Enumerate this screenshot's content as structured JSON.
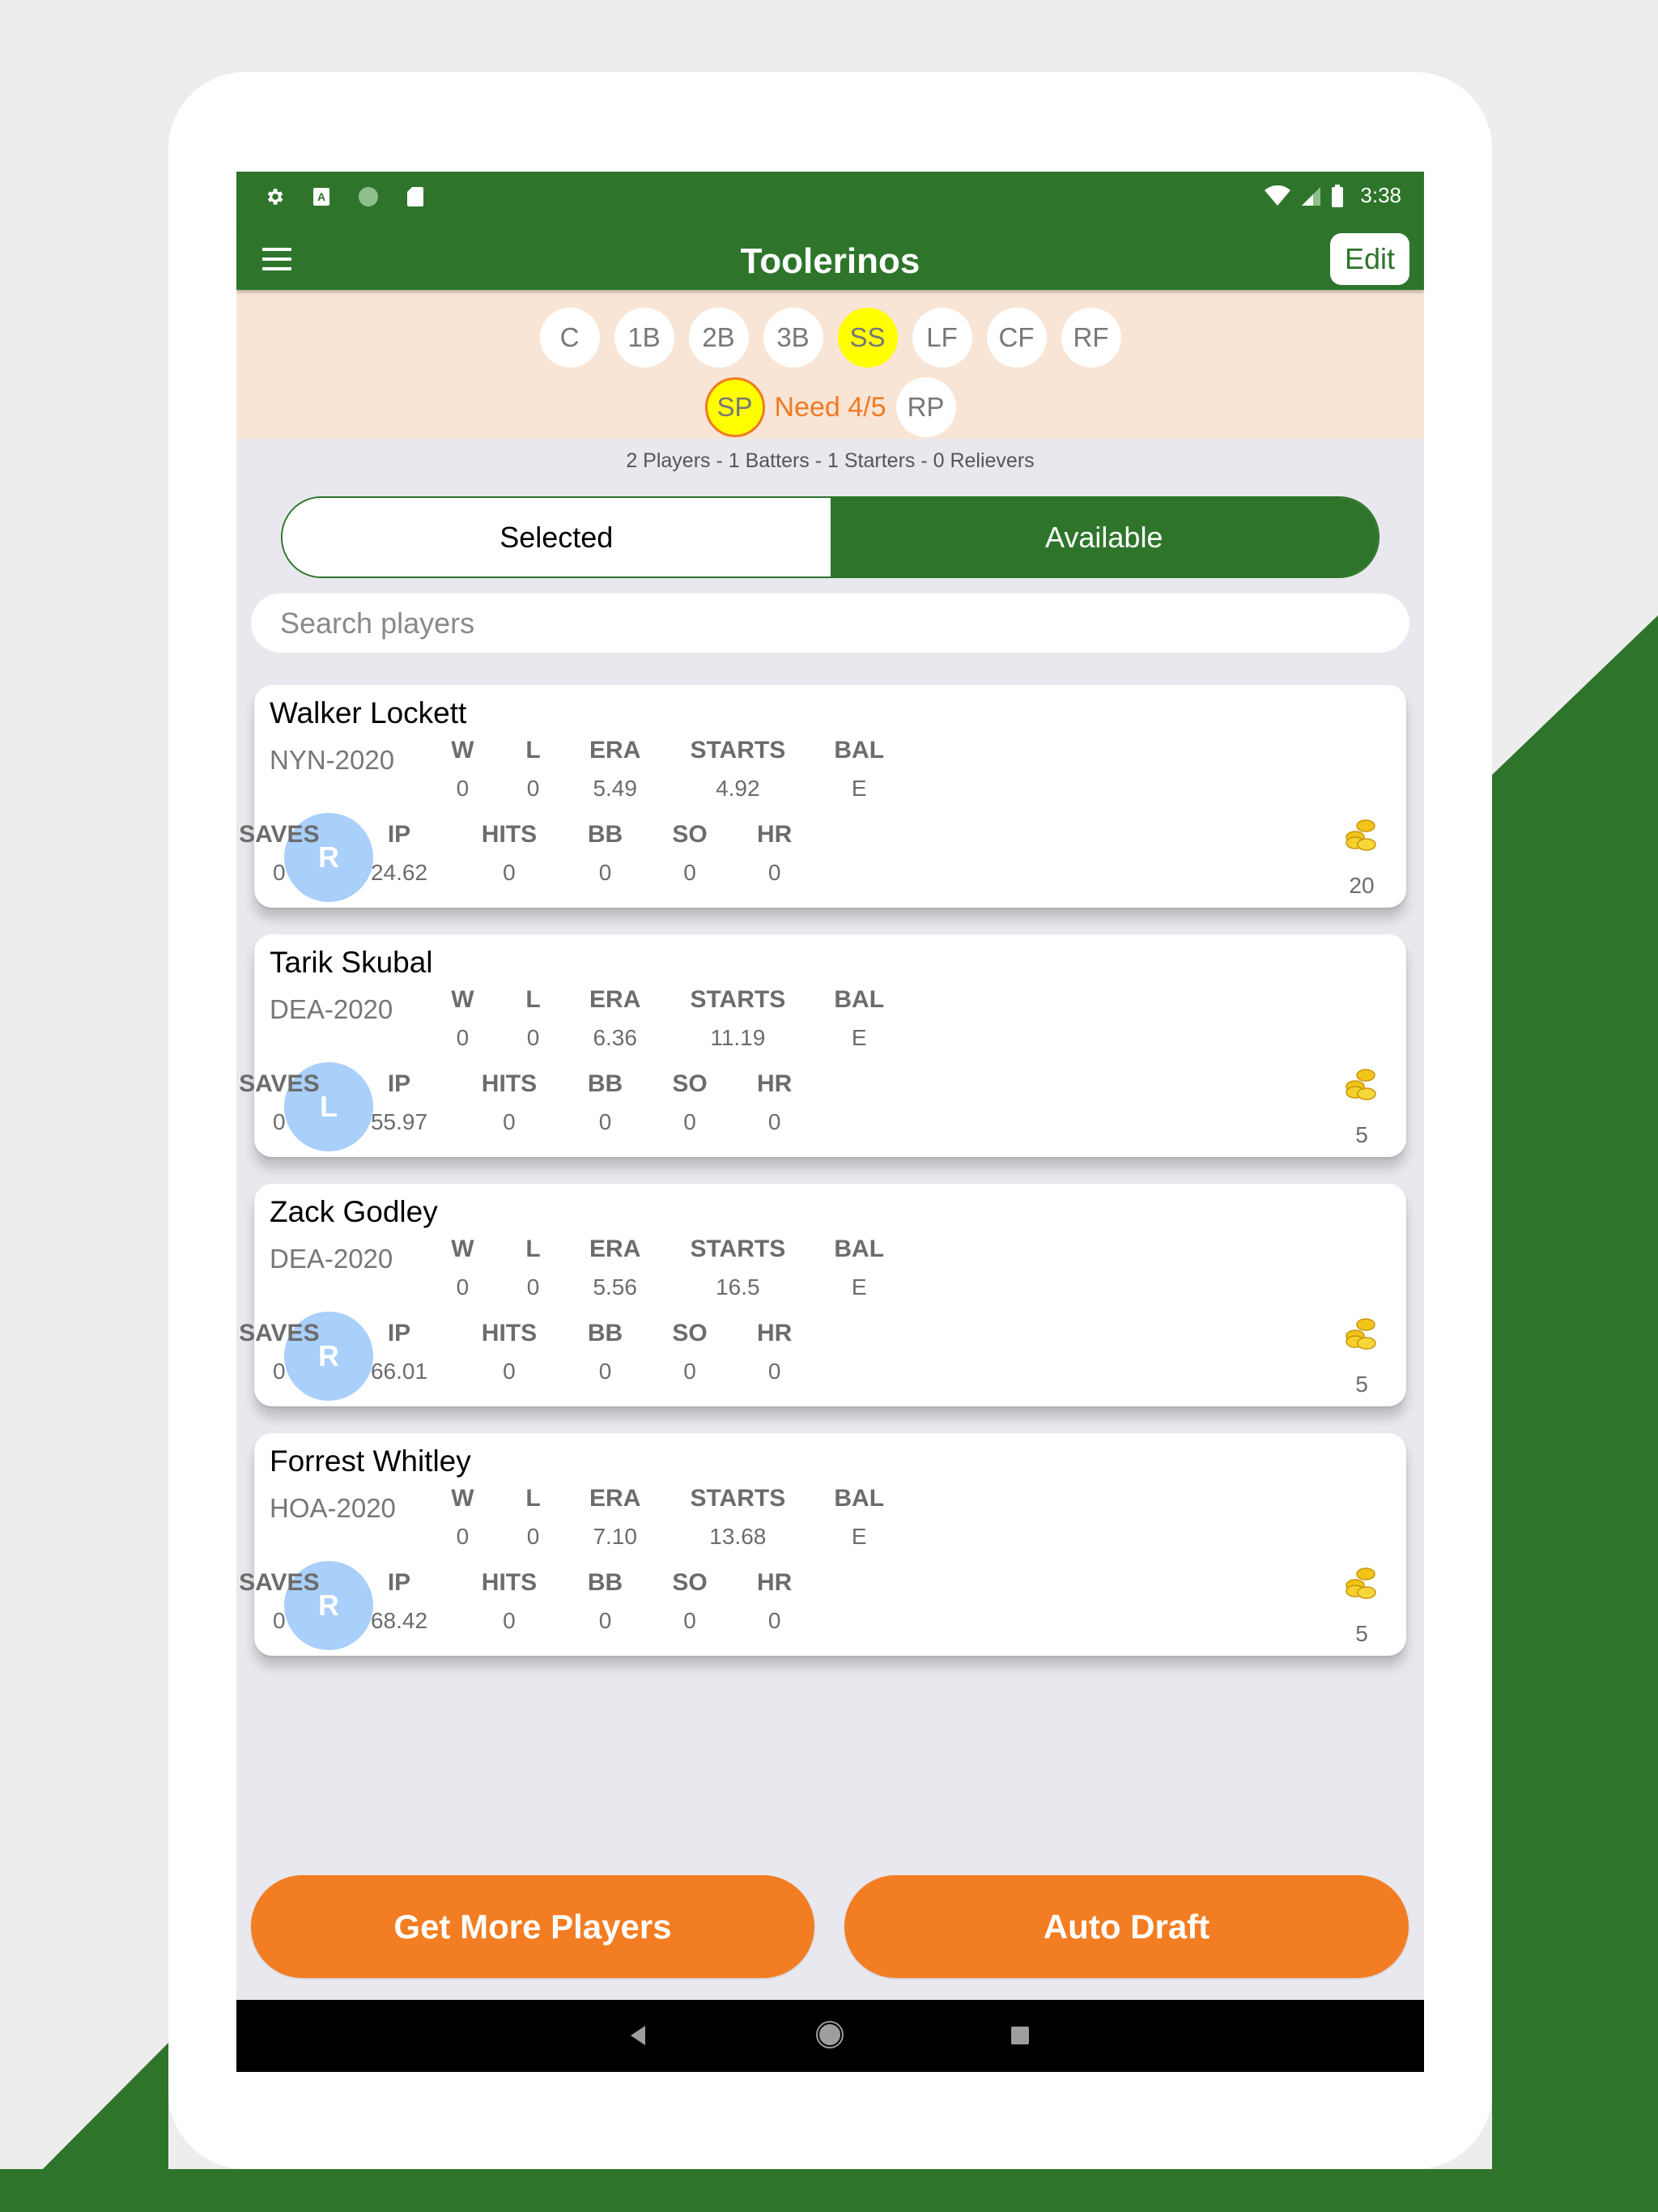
{
  "status_bar": {
    "left_icons": [
      "settings-icon",
      "keyboard-a-icon",
      "sync-icon",
      "sd-card-icon"
    ],
    "right_icons": [
      "wifi-icon",
      "signal-icon",
      "battery-icon"
    ],
    "time": "3:38"
  },
  "app_bar": {
    "menu_icon": "hamburger-menu-icon",
    "title": "Toolerinos",
    "edit_label": "Edit"
  },
  "positions": {
    "row1": [
      {
        "label": "C",
        "selected": false
      },
      {
        "label": "1B",
        "selected": false
      },
      {
        "label": "2B",
        "selected": false
      },
      {
        "label": "3B",
        "selected": false
      },
      {
        "label": "SS",
        "selected": true
      },
      {
        "label": "LF",
        "selected": false
      },
      {
        "label": "CF",
        "selected": false
      },
      {
        "label": "RF",
        "selected": false
      }
    ],
    "sp_label": "SP",
    "need_text": "Need 4/5",
    "rp_label": "RP"
  },
  "summary": "2 Players - 1 Batters - 1 Starters - 0 Relievers",
  "toggle": {
    "selected_label": "Selected",
    "available_label": "Available",
    "active": "Available"
  },
  "search": {
    "placeholder": "Search players",
    "value": ""
  },
  "stat_headers": {
    "w": "W",
    "l": "L",
    "era": "ERA",
    "starts": "STARTS",
    "bal": "BAL",
    "saves": "SAVES",
    "ip": "IP",
    "hits": "HITS",
    "bb": "BB",
    "so": "SO",
    "hr": "HR"
  },
  "players": [
    {
      "name": "Walker Lockett",
      "team": "NYN-2020",
      "hand": "R",
      "w": "0",
      "l": "0",
      "era": "5.49",
      "starts": "4.92",
      "bal": "E",
      "saves": "0",
      "ip": "24.62",
      "hits": "0",
      "bb": "0",
      "so": "0",
      "hr": "0",
      "cost": "20"
    },
    {
      "name": "Tarik Skubal",
      "team": "DEA-2020",
      "hand": "L",
      "w": "0",
      "l": "0",
      "era": "6.36",
      "starts": "11.19",
      "bal": "E",
      "saves": "0",
      "ip": "55.97",
      "hits": "0",
      "bb": "0",
      "so": "0",
      "hr": "0",
      "cost": "5"
    },
    {
      "name": "Zack Godley",
      "team": "DEA-2020",
      "hand": "R",
      "w": "0",
      "l": "0",
      "era": "5.56",
      "starts": "16.5",
      "bal": "E",
      "saves": "0",
      "ip": "66.01",
      "hits": "0",
      "bb": "0",
      "so": "0",
      "hr": "0",
      "cost": "5"
    },
    {
      "name": "Forrest Whitley",
      "team": "HOA-2020",
      "hand": "R",
      "w": "0",
      "l": "0",
      "era": "7.10",
      "starts": "13.68",
      "bal": "E",
      "saves": "0",
      "ip": "68.42",
      "hits": "0",
      "bb": "0",
      "so": "0",
      "hr": "0",
      "cost": "5"
    }
  ],
  "buttons": {
    "get_more": "Get More Players",
    "auto_draft": "Auto Draft"
  },
  "nav_bar": [
    "back-icon",
    "home-icon",
    "recents-icon"
  ],
  "colors": {
    "brand_green": "#2e752b",
    "accent_orange": "#f37d22",
    "position_band": "#f8e5d5",
    "highlight_yellow": "#ffff00",
    "avatar_blue": "#a9cffb"
  }
}
